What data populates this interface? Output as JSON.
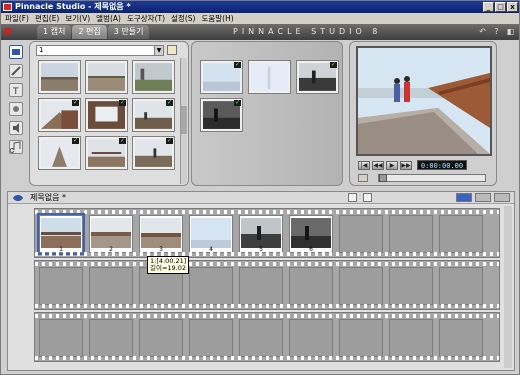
{
  "window": {
    "title": "Pinnacle Studio - 제목없음 *",
    "controls": [
      "_",
      "□",
      "x"
    ]
  },
  "menu": [
    "파일(F)",
    "편집(E)",
    "보기(V)",
    "앨범(A)",
    "도구상자(T)",
    "설정(S)",
    "도움말(H)"
  ],
  "tabs": [
    {
      "label": "1 캡처",
      "active": false
    },
    {
      "label": "2 편집",
      "active": true
    },
    {
      "label": "3 만들기",
      "active": false
    }
  ],
  "brand": "PINNACLE STUDIO 8",
  "album": {
    "selector_value": "1"
  },
  "player": {
    "timecode": "0:00:00.00"
  },
  "storyboard": {
    "title": "제목없음 *",
    "numbers": [
      "1",
      "2",
      "3",
      "4",
      "5",
      "6"
    ]
  },
  "tooltip": {
    "line1": "1:[4:00.21]",
    "line2": "길이=19.02"
  }
}
